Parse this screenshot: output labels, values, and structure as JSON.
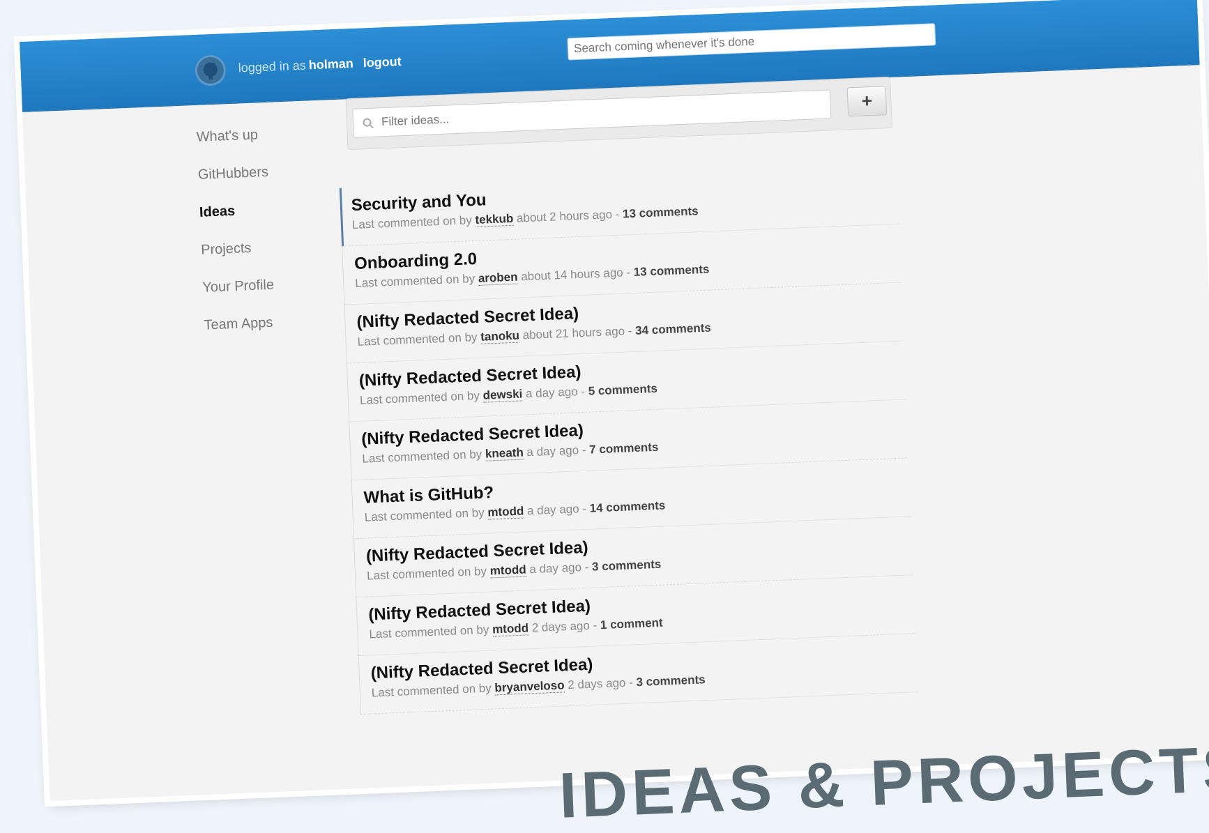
{
  "header": {
    "logged_in_prefix": "logged in as",
    "username": "holman",
    "logout_label": "logout",
    "search_placeholder": "Search coming whenever it's done"
  },
  "sidebar": {
    "items": [
      {
        "label": "What's up"
      },
      {
        "label": "GitHubbers"
      },
      {
        "label": "Ideas",
        "active": true
      },
      {
        "label": "Projects"
      },
      {
        "label": "Your Profile"
      },
      {
        "label": "Team Apps"
      }
    ]
  },
  "filter": {
    "placeholder": "Filter ideas...",
    "add_label": "+"
  },
  "ideas": [
    {
      "title": "Security and You",
      "prefix": "Last commented on by",
      "author": "tekkub",
      "time": "about 2 hours ago -",
      "count": "13 comments"
    },
    {
      "title": "Onboarding 2.0",
      "prefix": "Last commented on by",
      "author": "aroben",
      "time": "about 14 hours ago -",
      "count": "13 comments"
    },
    {
      "title": "(Nifty Redacted Secret Idea)",
      "prefix": "Last commented on by",
      "author": "tanoku",
      "time": "about 21 hours ago -",
      "count": "34 comments"
    },
    {
      "title": "(Nifty Redacted Secret Idea)",
      "prefix": "Last commented on by",
      "author": "dewski",
      "time": "a day ago -",
      "count": "5 comments"
    },
    {
      "title": "(Nifty Redacted Secret Idea)",
      "prefix": "Last commented on by",
      "author": "kneath",
      "time": "a day ago -",
      "count": "7 comments"
    },
    {
      "title": "What is GitHub?",
      "prefix": "Last commented on by",
      "author": "mtodd",
      "time": "a day ago -",
      "count": "14 comments"
    },
    {
      "title": "(Nifty Redacted Secret Idea)",
      "prefix": "Last commented on by",
      "author": "mtodd",
      "time": "a day ago -",
      "count": "3 comments"
    },
    {
      "title": "(Nifty Redacted Secret Idea)",
      "prefix": "Last commented on by",
      "author": "mtodd",
      "time": "2 days ago -",
      "count": "1 comment"
    },
    {
      "title": "(Nifty Redacted Secret Idea)",
      "prefix": "Last commented on by",
      "author": "bryanveloso",
      "time": "2 days ago -",
      "count": "3 comments"
    }
  ],
  "banner_text": "IDEAS & PROJECTS",
  "colors": {
    "topbar": "#2c8fd6",
    "page_bg": "#eef4fa",
    "banner": "#5b6b73"
  }
}
